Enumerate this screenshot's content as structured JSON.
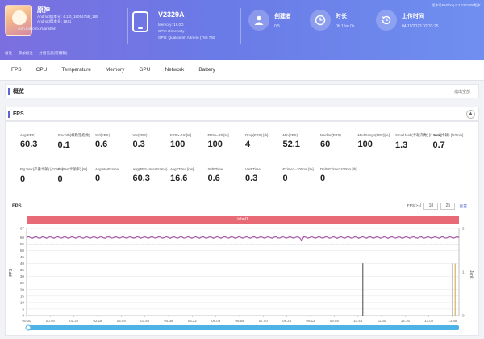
{
  "app": {
    "name": "原神",
    "meta_line1": "Android版本号: 4.1.0_18054758_185",
    "meta_line2": "Android版本号: 1841",
    "meta_line3": "com.miHoYo.Yuanshen",
    "sub_links": [
      "备注",
      "添加备注",
      "分组信息(可编辑)"
    ]
  },
  "device": {
    "name": "V2329A",
    "line1": "Memory: 16.0G",
    "line2": "CPU: Dimensity",
    "line3": "GPU: Qualcomm Adreno (TM) 750"
  },
  "stats": {
    "creator_label": "创建者",
    "creator_value": "0.5",
    "duration_label": "时长",
    "duration_value": "0h 15m 0s",
    "upload_label": "上传时间",
    "upload_value": "04/11/2023 02:33:25",
    "top_right": "版本号PerfDog 9.3 2310406版本"
  },
  "tabs": [
    "FPS",
    "CPU",
    "Temperature",
    "Memory",
    "GPU",
    "Network",
    "Battery"
  ],
  "overview": {
    "title": "概览",
    "right": "指出全部"
  },
  "fps_panel": {
    "title": "FPS",
    "collapse": "▲",
    "metrics_row1": [
      {
        "label": "Avg(FPS)",
        "value": "60.3"
      },
      {
        "label": "Smooth(帧稳定指数)",
        "value": "0.1"
      },
      {
        "label": "Std(FPS)",
        "value": "0.6"
      },
      {
        "label": "Var(FPS)",
        "value": "0.3"
      },
      {
        "label": "FPS>=18 [%]",
        "value": "100"
      },
      {
        "label": "FPS>=25 [%]",
        "value": "100"
      },
      {
        "label": "Drop(FPS) [/h]",
        "value": "4"
      },
      {
        "label": "Min(FPS)",
        "value": "52.1"
      },
      {
        "label": "Median(FPS)",
        "value": "60"
      },
      {
        "label": "MedRange(FPS)[%]",
        "value": "100"
      },
      {
        "label": "SmallJank(卡顿次数) [/10min]",
        "value": "1.3"
      },
      {
        "label": "Jank(卡顿) [/10min]",
        "value": "0.7"
      }
    ],
    "metrics_row2": [
      {
        "label": "BigJank(严重卡顿) [/10min]",
        "value": "0"
      },
      {
        "label": "Stutter(卡顿率) [%]",
        "value": "0"
      },
      {
        "label": "AvgInterFrame",
        "value": "0"
      },
      {
        "label": "Avg(FPS+InterFrame)",
        "value": "60.3"
      },
      {
        "label": "AvgFTime [ms]",
        "value": "16.6"
      },
      {
        "label": "StdFTime",
        "value": "0.6"
      },
      {
        "label": "VarFTime",
        "value": "0.3"
      },
      {
        "label": "FTime>=100ms [%]",
        "value": "0"
      },
      {
        "label": "DeltaFTime>100ms [/h]",
        "value": "0"
      }
    ]
  },
  "chart": {
    "title": "FPS",
    "range_label": "FPS[>=]",
    "range_min": "18",
    "range_max": "25",
    "range_link": "重置",
    "banner": "label1",
    "y_label": "FPS",
    "right_label": "Jank"
  },
  "chart_data": {
    "type": "line",
    "ylim": [
      0,
      67
    ],
    "yticks": [
      0,
      5,
      10,
      15,
      20,
      25,
      30,
      35,
      40,
      45,
      50,
      55,
      60,
      67
    ],
    "right_yticks": [
      0,
      1,
      2
    ],
    "xticks": [
      "00:00",
      "00:46",
      "01:32",
      "02:18",
      "03:04",
      "03:50",
      "04:36",
      "05:22",
      "06:08",
      "06:54",
      "07:40",
      "08:26",
      "09:12",
      "09:58",
      "10:44",
      "11:30",
      "12:16",
      "13:02",
      "13:48"
    ],
    "series": [
      {
        "name": "FPS",
        "color": "#a85aa8",
        "x": [
          0,
          0.46,
          1.5,
          3,
          4.5,
          6,
          7.5,
          9,
          10.5,
          12,
          13.8
        ],
        "values": [
          60,
          60,
          60,
          60,
          60,
          60,
          60,
          60,
          60,
          60,
          60
        ]
      },
      {
        "name": "Jank",
        "color": "#666666",
        "x": [
          10.73,
          13.6
        ],
        "values": [
          1.2,
          1.2
        ]
      }
    ],
    "grid": true
  }
}
